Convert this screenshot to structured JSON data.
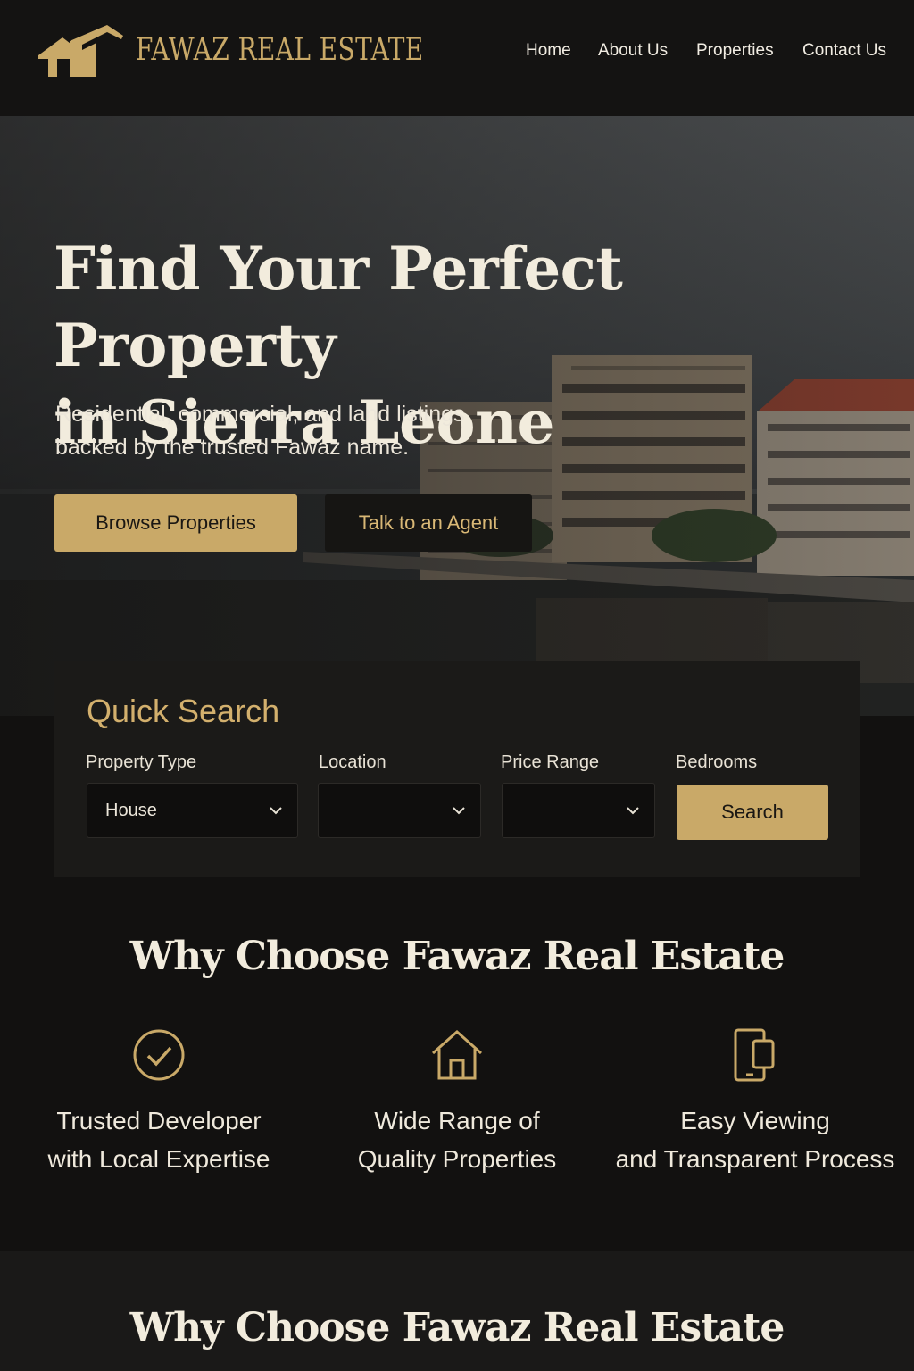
{
  "header": {
    "brand": "FAWAZ REAL ESTATE",
    "logo_icon": "house-roof-logo",
    "nav": [
      "Home",
      "About Us",
      "Properties",
      "Contact Us"
    ]
  },
  "hero": {
    "title_line1": "Find Your Perfect Property",
    "title_line2": "in Sierra Leone",
    "subtitle_line1": "Residential, commercial, and land listings",
    "subtitle_line2": "backed by the trusted Fawaz name.",
    "primary_button": "Browse Properties",
    "secondary_button": "Talk to an Agent"
  },
  "quick_search": {
    "title": "Quick Search",
    "fields": [
      {
        "label": "Property Type",
        "value": "House"
      },
      {
        "label": "Location",
        "value": ""
      },
      {
        "label": "Price Range",
        "value": ""
      },
      {
        "label": "Bedrooms",
        "value": ""
      }
    ],
    "search_button": "Search"
  },
  "why": {
    "title": "Why Choose Fawaz Real Estate",
    "features": [
      {
        "icon": "check-circle-icon",
        "line1": "Trusted Developer",
        "line2": "with Local Expertise"
      },
      {
        "icon": "house-icon",
        "line1": "Wide Range of",
        "line2": "Quality Properties"
      },
      {
        "icon": "devices-icon",
        "line1": "Easy Viewing",
        "line2": "and Transparent Process"
      }
    ]
  },
  "second_section": {
    "title": "Why Choose Fawaz Real Estate"
  },
  "colors": {
    "gold": "#c9a968",
    "background": "#121110",
    "panel": "#1b1a18"
  }
}
